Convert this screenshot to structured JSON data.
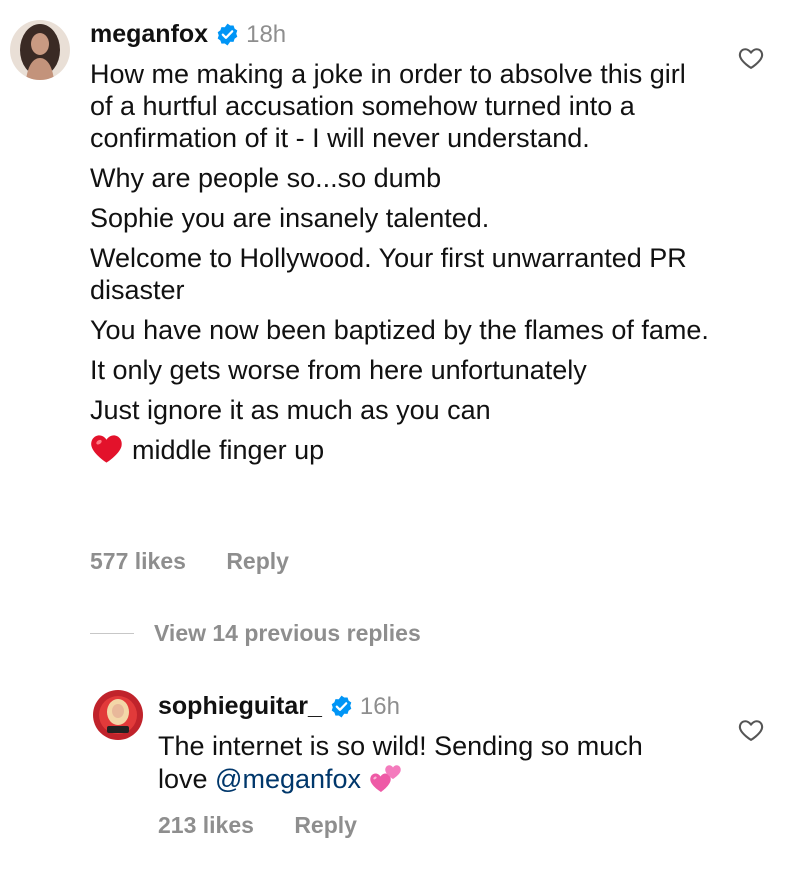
{
  "comments": [
    {
      "username": "meganfox",
      "time": "18h",
      "lines": [
        "How me making a joke in order to absolve this girl of a hurtful accusation somehow turned into a confirmation of it - I will never understand.",
        "Why are people so...so dumb",
        "Sophie you are insanely talented.",
        "Welcome to Hollywood. Your first unwarranted PR disaster",
        "You have now been baptized by the flames of fame.",
        "It only gets worse from here unfortunately",
        "Just ignore it as much as you can"
      ],
      "last_line_text": "middle finger up",
      "last_line_emoji": "red-heart-emoji",
      "likes": "577 likes",
      "reply_label": "Reply"
    }
  ],
  "view_replies": "View 14 previous replies",
  "reply": {
    "username": "sophieguitar_",
    "time": "16h",
    "text_before": "The internet is so wild! Sending so much love",
    "mention": "@meganfox",
    "emoji": "two-hearts-emoji",
    "likes": "213 likes",
    "reply_label": "Reply"
  },
  "icons": {
    "verified": "verified-badge-icon",
    "like": "heart-outline-icon"
  },
  "colors": {
    "verified": "#0095f6",
    "secondary_text": "#8e8e8e",
    "mention": "#00376b"
  }
}
